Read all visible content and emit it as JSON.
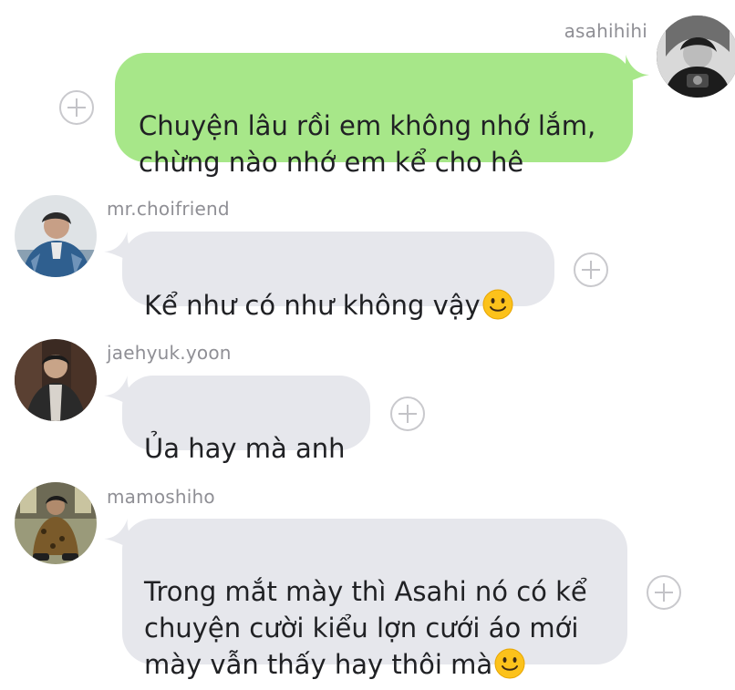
{
  "messages": [
    {
      "sender": "asahihihi",
      "direction": "outgoing",
      "text": "Chuyện lâu rồi em không nhớ lắm,\nchừng nào nhớ em kể cho hê",
      "emoji": null
    },
    {
      "sender": "mr.choifriend",
      "direction": "incoming",
      "text": "Kể như có như không vậy",
      "emoji": "slightly-smiling-face"
    },
    {
      "sender": "jaehyuk.yoon",
      "direction": "incoming",
      "text": "Ủa hay mà anh",
      "emoji": null
    },
    {
      "sender": "mamoshiho",
      "direction": "incoming",
      "text": "Trong mắt mày thì Asahi nó có kể\nchuyện cười kiểu lợn cưới áo mới\nmày vẫn thấy hay thôi mà",
      "emoji": "slightly-smiling-face"
    }
  ],
  "colors": {
    "outgoing_bubble": "#a7e789",
    "incoming_bubble": "#e6e7ec",
    "username": "#8f8f95",
    "add_reaction_icon": "#c9c9cd"
  },
  "icons": {
    "add_reaction": "plus-circle-icon",
    "emoji": "slightly-smiling-face-icon"
  }
}
